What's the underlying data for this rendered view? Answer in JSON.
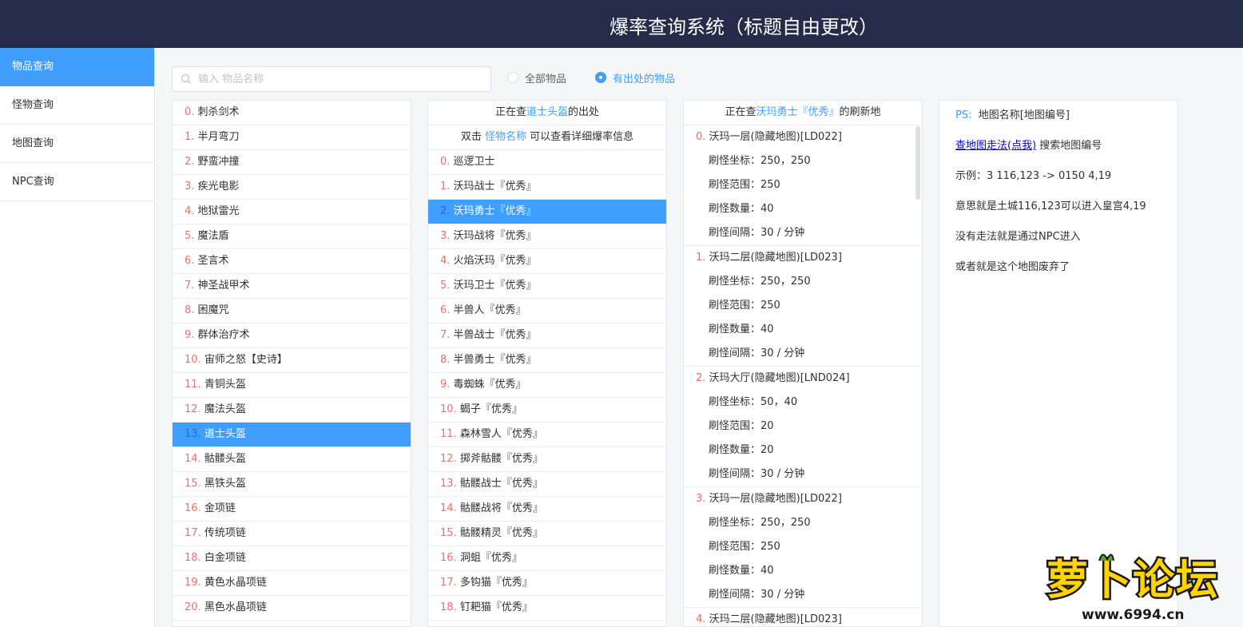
{
  "header": {
    "title": "爆率查询系统（标题自由更改）"
  },
  "sidebar": {
    "items": [
      {
        "label": "物品查询",
        "active": true
      },
      {
        "label": "怪物查询",
        "active": false
      },
      {
        "label": "地图查询",
        "active": false
      },
      {
        "label": "NPC查询",
        "active": false
      }
    ]
  },
  "search": {
    "placeholder": "输入 物品名称",
    "value": ""
  },
  "filters": [
    {
      "label": "全部物品",
      "checked": false
    },
    {
      "label": "有出处的物品",
      "checked": true
    }
  ],
  "items_list": [
    {
      "num": "0.",
      "name": "刺杀剑术"
    },
    {
      "num": "1.",
      "name": "半月弯刀"
    },
    {
      "num": "2.",
      "name": "野蛮冲撞"
    },
    {
      "num": "3.",
      "name": "疾光电影"
    },
    {
      "num": "4.",
      "name": "地狱雷光"
    },
    {
      "num": "5.",
      "name": "魔法盾"
    },
    {
      "num": "6.",
      "name": "圣言术"
    },
    {
      "num": "7.",
      "name": "神圣战甲术"
    },
    {
      "num": "8.",
      "name": "困魔咒"
    },
    {
      "num": "9.",
      "name": "群体治疗术"
    },
    {
      "num": "10.",
      "name": "宙师之怒【史诗】"
    },
    {
      "num": "11.",
      "name": "青铜头盔"
    },
    {
      "num": "12.",
      "name": "魔法头盔"
    },
    {
      "num": "13.",
      "name": "道士头盔",
      "active": true
    },
    {
      "num": "14.",
      "name": "骷髅头盔"
    },
    {
      "num": "15.",
      "name": "黑铁头盔"
    },
    {
      "num": "16.",
      "name": "金项链"
    },
    {
      "num": "17.",
      "name": "传统项链"
    },
    {
      "num": "18.",
      "name": "白金项链"
    },
    {
      "num": "19.",
      "name": "黄色水晶项链"
    },
    {
      "num": "20.",
      "name": "黑色水晶项链"
    }
  ],
  "monsters_panel": {
    "header_prefix": "正在查",
    "header_item": "道士头盔",
    "header_suffix": "的出处",
    "hint_prefix": "双击 ",
    "hint_hl": "怪物名称",
    "hint_suffix": " 可以查看详细爆率信息",
    "rows": [
      {
        "num": "0.",
        "name": "巡逻卫士"
      },
      {
        "num": "1.",
        "name": "沃玛战士『优秀』"
      },
      {
        "num": "2.",
        "name": "沃玛勇士『优秀』",
        "active": true
      },
      {
        "num": "3.",
        "name": "沃玛战将『优秀』"
      },
      {
        "num": "4.",
        "name": "火焰沃玛『优秀』"
      },
      {
        "num": "5.",
        "name": "沃玛卫士『优秀』"
      },
      {
        "num": "6.",
        "name": "半兽人『优秀』"
      },
      {
        "num": "7.",
        "name": "半兽战士『优秀』"
      },
      {
        "num": "8.",
        "name": "半兽勇士『优秀』"
      },
      {
        "num": "9.",
        "name": "毒蜘蛛『优秀』"
      },
      {
        "num": "10.",
        "name": "蝎子『优秀』"
      },
      {
        "num": "11.",
        "name": "森林雪人『优秀』"
      },
      {
        "num": "12.",
        "name": "掷斧骷髅『优秀』"
      },
      {
        "num": "13.",
        "name": "骷髅战士『优秀』"
      },
      {
        "num": "14.",
        "name": "骷髅战将『优秀』"
      },
      {
        "num": "15.",
        "name": "骷髅精灵『优秀』"
      },
      {
        "num": "16.",
        "name": "洞蛆『优秀』"
      },
      {
        "num": "17.",
        "name": "多钩猫『优秀』"
      },
      {
        "num": "18.",
        "name": "钉耙猫『优秀』"
      }
    ]
  },
  "spawns_panel": {
    "header_prefix": "正在查",
    "header_monster": "沃玛勇士『优秀』",
    "header_suffix": "的刷新地",
    "labels": {
      "coord": "刷怪坐标：",
      "range": "刷怪范围：",
      "count": "刷怪数量：",
      "interval": "刷怪间隔："
    },
    "spawns": [
      {
        "num": "0.",
        "map": "沃玛一层(隐藏地图)[LD022]",
        "coord": "250，250",
        "range": "250",
        "count": "40",
        "interval": "30 / 分钟"
      },
      {
        "num": "1.",
        "map": "沃玛二层(隐藏地图)[LD023]",
        "coord": "250，250",
        "range": "250",
        "count": "40",
        "interval": "30 / 分钟"
      },
      {
        "num": "2.",
        "map": "沃玛大厅(隐藏地图)[LND024]",
        "coord": "50，40",
        "range": "20",
        "count": "20",
        "interval": "30 / 分钟"
      },
      {
        "num": "3.",
        "map": "沃玛一层(隐藏地图)[LD022]",
        "coord": "250，250",
        "range": "250",
        "count": "40",
        "interval": "30 / 分钟"
      },
      {
        "num": "4.",
        "map": "沃玛二层(隐藏地图)[LD023]"
      }
    ]
  },
  "info_panel": {
    "ps_label": "PS:",
    "ps_text": "地图名称[地图编号]",
    "link_text": "查地图走法(点我)",
    "link_suffix": "搜索地图编号",
    "example": "示例：3 116,123 -> 0150 4,19",
    "meaning": "意思就是土城116,123可以进入皇宫4,19",
    "npc_note": "没有走法就是通过NPC进入",
    "abandoned": "或者就是这个地图废弃了"
  },
  "watermark": {
    "brand": "萝卜论坛",
    "url": "www.6994.cn"
  },
  "colors": {
    "header_bg": "#252b48",
    "accent": "#409eff",
    "index": "#f56c6c"
  }
}
